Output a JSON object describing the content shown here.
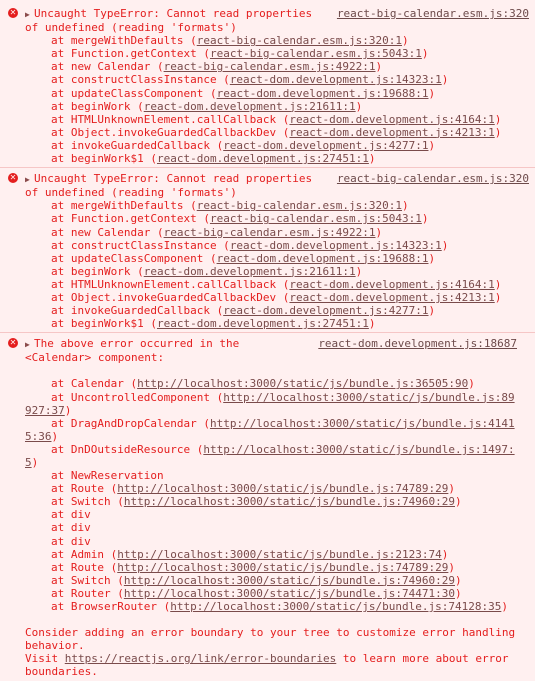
{
  "errors": [
    {
      "message_line1": "Uncaught TypeError: Cannot read properties",
      "source": "react-big-calendar.esm.js:320",
      "message_line2": "of undefined (reading 'formats')",
      "stack": [
        {
          "at": "at mergeWithDefaults (",
          "link": "react-big-calendar.esm.js:320:1",
          "close": ")"
        },
        {
          "at": "at Function.getContext (",
          "link": "react-big-calendar.esm.js:5043:1",
          "close": ")"
        },
        {
          "at": "at new Calendar (",
          "link": "react-big-calendar.esm.js:4922:1",
          "close": ")"
        },
        {
          "at": "at constructClassInstance (",
          "link": "react-dom.development.js:14323:1",
          "close": ")"
        },
        {
          "at": "at updateClassComponent (",
          "link": "react-dom.development.js:19688:1",
          "close": ")"
        },
        {
          "at": "at beginWork (",
          "link": "react-dom.development.js:21611:1",
          "close": ")"
        },
        {
          "at": "at HTMLUnknownElement.callCallback (",
          "link": "react-dom.development.js:4164:1",
          "close": ")"
        },
        {
          "at": "at Object.invokeGuardedCallbackDev (",
          "link": "react-dom.development.js:4213:1",
          "close": ")"
        },
        {
          "at": "at invokeGuardedCallback (",
          "link": "react-dom.development.js:4277:1",
          "close": ")"
        },
        {
          "at": "at beginWork$1 (",
          "link": "react-dom.development.js:27451:1",
          "close": ")"
        }
      ]
    },
    {
      "message_line1": "Uncaught TypeError: Cannot read properties",
      "source": "react-big-calendar.esm.js:320",
      "message_line2": "of undefined (reading 'formats')",
      "stack": [
        {
          "at": "at mergeWithDefaults (",
          "link": "react-big-calendar.esm.js:320:1",
          "close": ")"
        },
        {
          "at": "at Function.getContext (",
          "link": "react-big-calendar.esm.js:5043:1",
          "close": ")"
        },
        {
          "at": "at new Calendar (",
          "link": "react-big-calendar.esm.js:4922:1",
          "close": ")"
        },
        {
          "at": "at constructClassInstance (",
          "link": "react-dom.development.js:14323:1",
          "close": ")"
        },
        {
          "at": "at updateClassComponent (",
          "link": "react-dom.development.js:19688:1",
          "close": ")"
        },
        {
          "at": "at beginWork (",
          "link": "react-dom.development.js:21611:1",
          "close": ")"
        },
        {
          "at": "at HTMLUnknownElement.callCallback (",
          "link": "react-dom.development.js:4164:1",
          "close": ")"
        },
        {
          "at": "at Object.invokeGuardedCallbackDev (",
          "link": "react-dom.development.js:4213:1",
          "close": ")"
        },
        {
          "at": "at invokeGuardedCallback (",
          "link": "react-dom.development.js:4277:1",
          "close": ")"
        },
        {
          "at": "at beginWork$1 (",
          "link": "react-dom.development.js:27451:1",
          "close": ")"
        }
      ]
    }
  ],
  "third": {
    "message_line1": "The above error occurred in the",
    "source": "react-dom.development.js:18687",
    "message_line2": "<Calendar> component:",
    "stack": [
      {
        "at": "at Calendar (",
        "link": "http://localhost:3000/static/js/bundle.js:36505:90",
        "close": ")"
      },
      {
        "at": "at UncontrolledComponent (",
        "link": "http://localhost:3000/static/js/bundle.js:89",
        "cont": "927:37",
        "close": ")"
      },
      {
        "at": "at DragAndDropCalendar (",
        "link": "http://localhost:3000/static/js/bundle.js:4141",
        "cont": "5:36",
        "close": ")"
      },
      {
        "at": "at DnDOutsideResource (",
        "link": "http://localhost:3000/static/js/bundle.js:1497:",
        "cont": "5",
        "close": ")"
      },
      {
        "at": "at NewReservation",
        "link": "",
        "close": ""
      },
      {
        "at": "at Route (",
        "link": "http://localhost:3000/static/js/bundle.js:74789:29",
        "close": ")"
      },
      {
        "at": "at Switch (",
        "link": "http://localhost:3000/static/js/bundle.js:74960:29",
        "close": ")"
      },
      {
        "at": "at div",
        "link": "",
        "close": ""
      },
      {
        "at": "at div",
        "link": "",
        "close": ""
      },
      {
        "at": "at div",
        "link": "",
        "close": ""
      },
      {
        "at": "at Admin (",
        "link": "http://localhost:3000/static/js/bundle.js:2123:74",
        "close": ")"
      },
      {
        "at": "at Route (",
        "link": "http://localhost:3000/static/js/bundle.js:74789:29",
        "close": ")"
      },
      {
        "at": "at Switch (",
        "link": "http://localhost:3000/static/js/bundle.js:74960:29",
        "close": ")"
      },
      {
        "at": "at Router (",
        "link": "http://localhost:3000/static/js/bundle.js:74471:30",
        "close": ")"
      },
      {
        "at": "at BrowserRouter (",
        "link": "http://localhost:3000/static/js/bundle.js:74128:35",
        "close": ")"
      }
    ],
    "advice_line1": "Consider adding an error boundary to your tree to customize error handling",
    "advice_line2": "behavior.",
    "visit_prefix": "Visit ",
    "visit_link": "https://reactjs.org/link/error-boundaries",
    "visit_suffix": " to learn more about error",
    "visit_line2": "boundaries."
  },
  "icons": {
    "error": "error-circle-icon",
    "expand": "expand-triangle-icon"
  },
  "colors": {
    "background": "#fff0f0",
    "text": "#e41e1e",
    "link": "#7a4b4b",
    "divider": "#f6c6c6"
  }
}
